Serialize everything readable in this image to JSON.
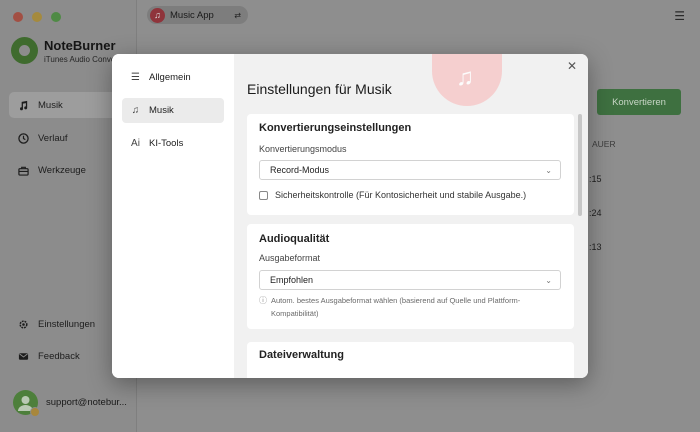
{
  "sidebar": {
    "brand_title": "NoteBurner",
    "brand_subtitle": "iTunes Audio Conver",
    "items": [
      {
        "label": "Musik",
        "icon": "music-note-icon",
        "active": true
      },
      {
        "label": "Verlauf",
        "icon": "clock-icon",
        "active": false
      },
      {
        "label": "Werkzeuge",
        "icon": "toolbox-icon",
        "active": false
      }
    ],
    "bottom_items": [
      {
        "label": "Einstellungen",
        "icon": "gear-icon"
      },
      {
        "label": "Feedback",
        "icon": "mail-icon"
      }
    ],
    "user_email": "support@notebur..."
  },
  "topbar": {
    "source_label": "Music App",
    "menu_glyph": "☰"
  },
  "main": {
    "convert_label": "Konvertieren",
    "duration_header": "AUER",
    "durations": [
      ":15",
      ":24",
      ":13"
    ]
  },
  "modal": {
    "nav": [
      {
        "label": "Allgemein",
        "icon": "sliders-icon",
        "glyph": "☰"
      },
      {
        "label": "Musik",
        "icon": "music-note-icon",
        "glyph": "♫"
      },
      {
        "label": "KI-Tools",
        "icon": "ai-icon",
        "glyph": "Ai"
      }
    ],
    "close_glyph": "✕",
    "title": "Einstellungen für Musik",
    "conversion": {
      "title": "Konvertierungseinstellungen",
      "mode_label": "Konvertierungsmodus",
      "mode_value": "Record-Modus",
      "security_check_label": "Sicherheitskontrolle (Für Kontosicherheit und stabile Ausgabe.)",
      "security_check_checked": false
    },
    "audio": {
      "title": "Audioqualität",
      "format_label": "Ausgabeformat",
      "format_value": "Empfohlen",
      "hint": "Autom. bestes Ausgabeformat wählen (basierend auf Quelle und Plattform-Kompatibilität)"
    },
    "files": {
      "title": "Dateiverwaltung"
    }
  },
  "colors": {
    "accent_green": "#3e7040",
    "music_red": "#8f343b"
  }
}
